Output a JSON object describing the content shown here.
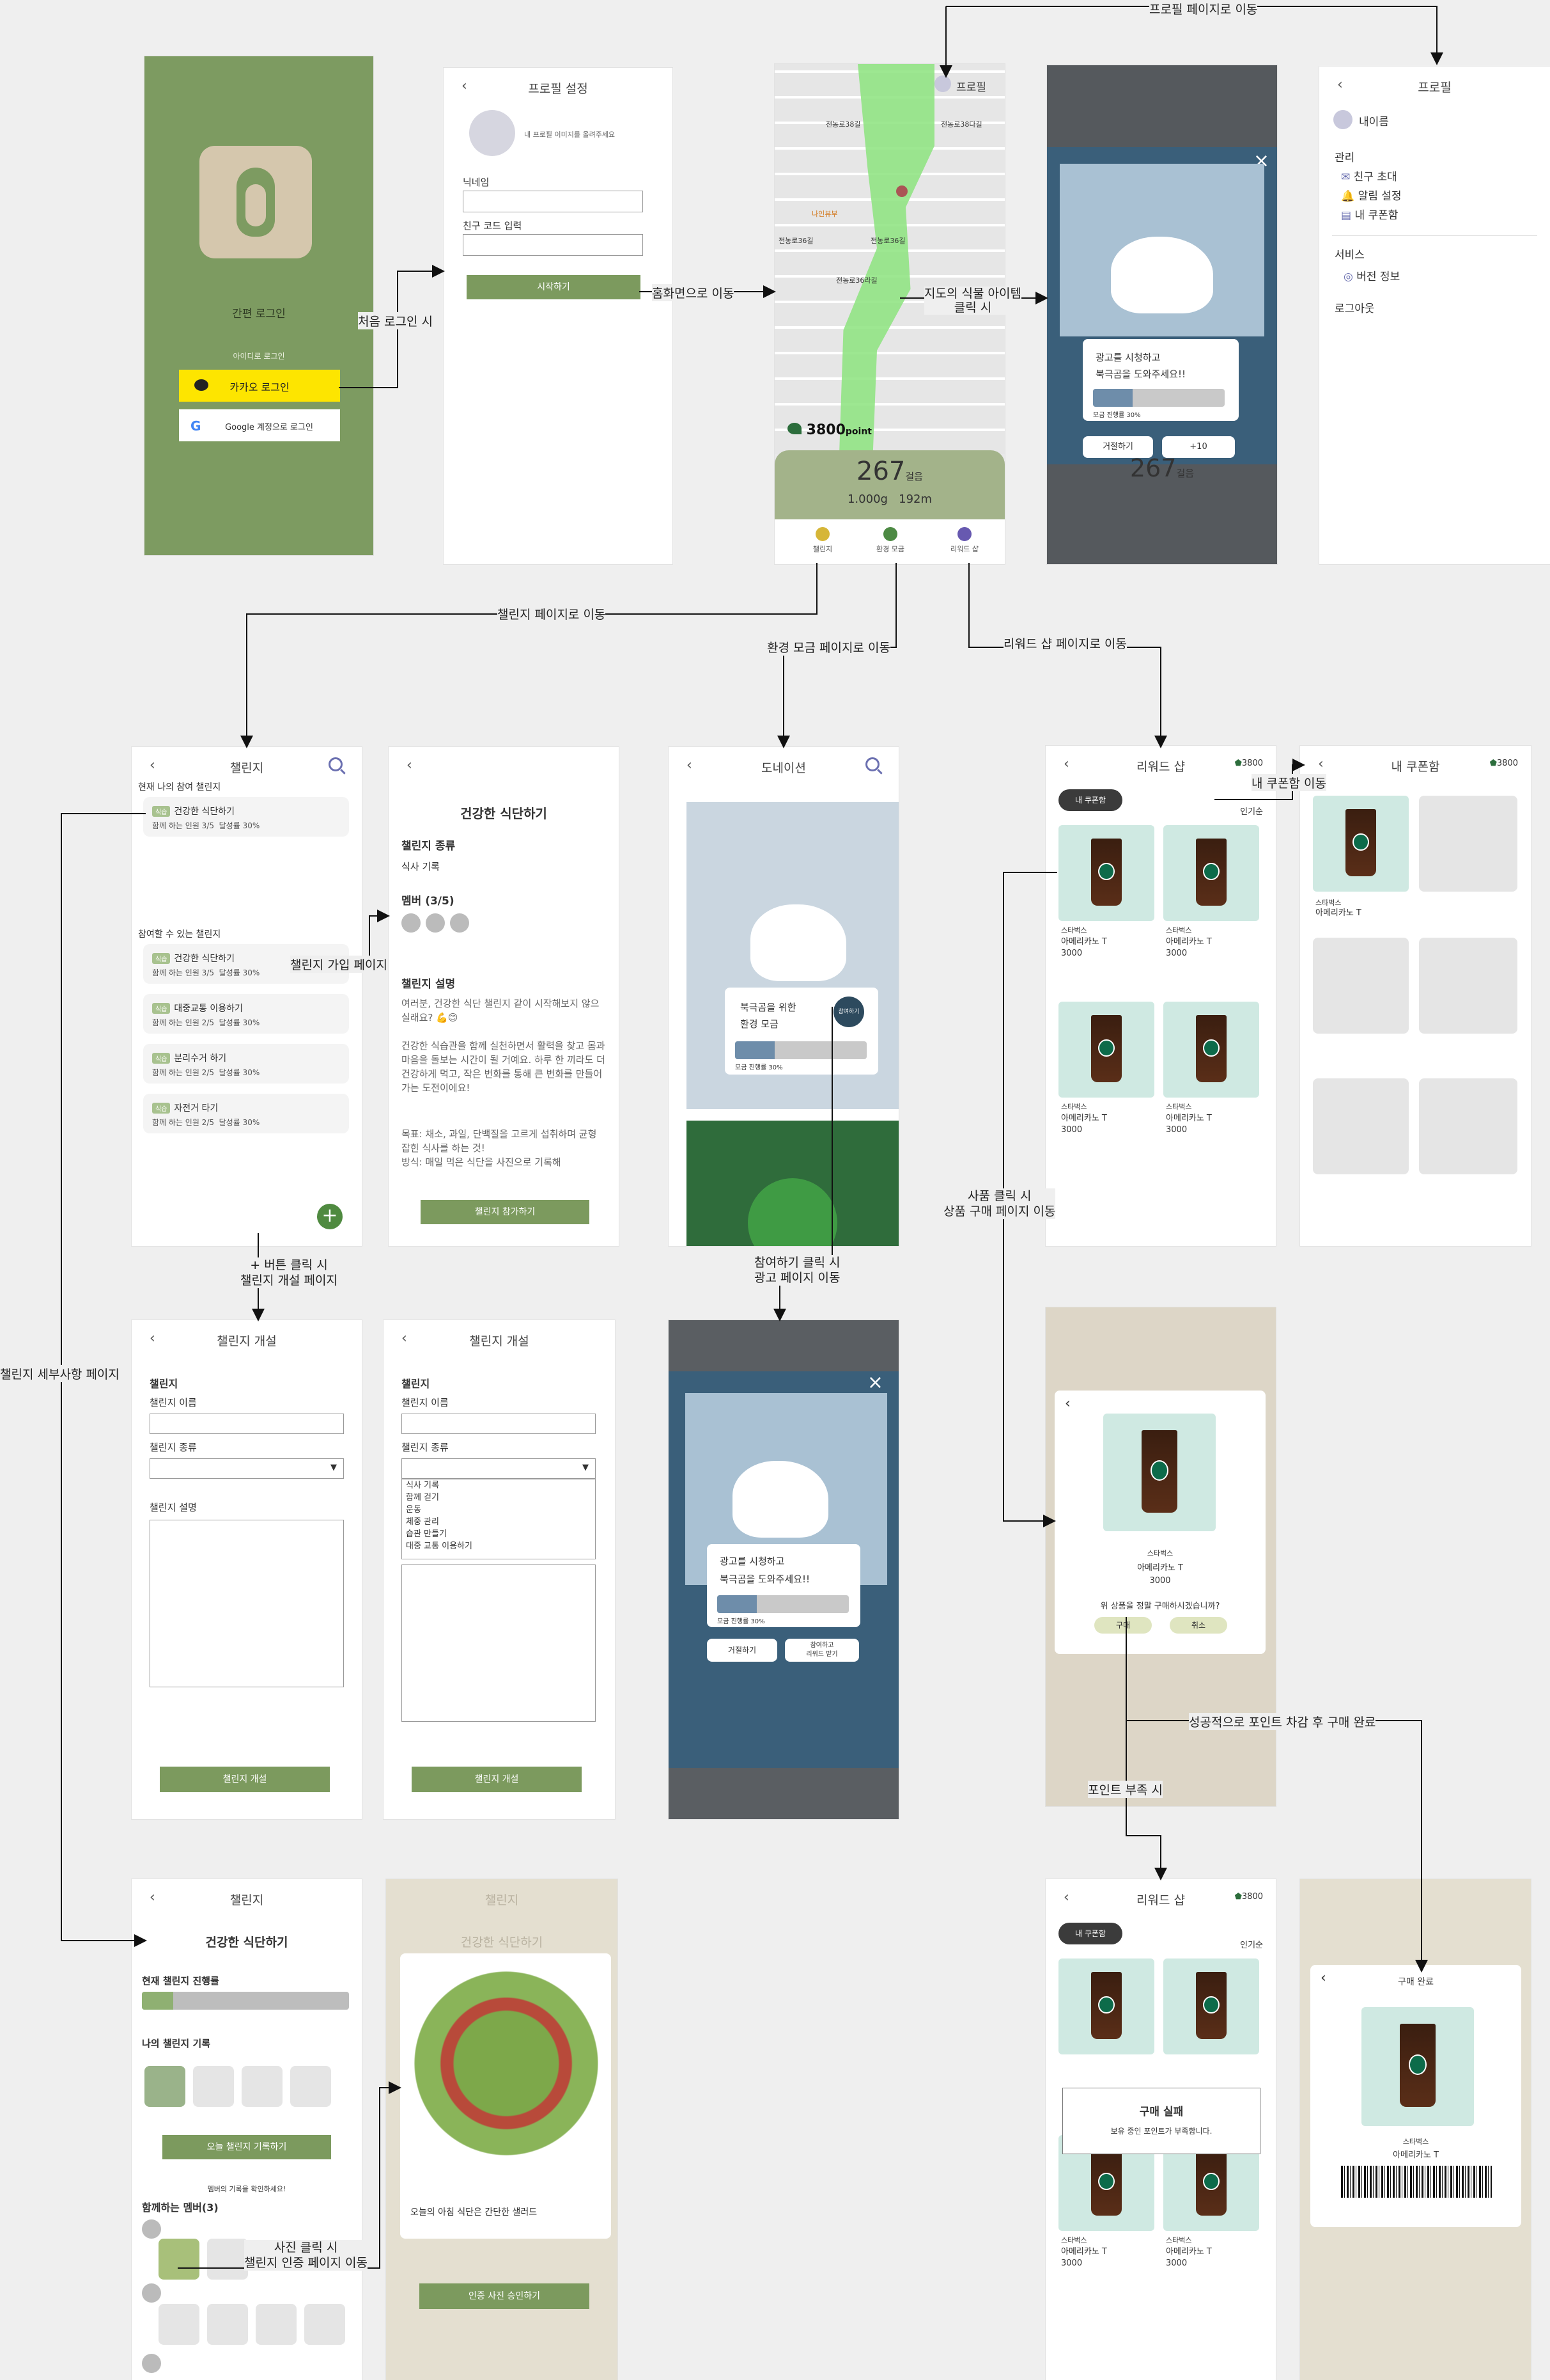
{
  "flow_labels": {
    "first_login": "처음 로그인 시",
    "to_home": "홈화면으로 이동",
    "plant_item_click": "지도의 식물 아이템\n클릭 시",
    "to_profile": "프로필 페이지로 이동",
    "to_challenge": "챌린지 페이지로 이동",
    "to_env": "환경 모금 페이지로 이동",
    "to_reward": "리워드 샵 페이지로 이동",
    "join_challenge": "챌린지 가입 페이지",
    "my_coupon_move": "내 쿠폰함 이동",
    "plus_click": "+ 버튼 클릭 시\n챌린지 개설 페이지",
    "participate_click": "참여하기 클릭 시\n광고 페이지 이동",
    "product_click": "사품 클릭 시\n상품 구매 페이지 이동",
    "challenge_detail": "챌린지 세부사항 페이지",
    "point_success": "성공적으로 포인트 차감 후 구매 완료",
    "point_short": "포인트 부족 시",
    "photo_click": "사진 클릭 시\n챌린지 인증 페이지 이동"
  },
  "login": {
    "simple_login": "간편 로그인",
    "id_login": "아이디로 로그인",
    "kakao": "카카오 로그인",
    "google": "Google 계정으로 로그인"
  },
  "profile_setup": {
    "title": "프로필 설정",
    "photo_hint": "내 프로필 이미지를 올려주세요",
    "nickname": "닉네임",
    "friend_code": "친구 코드 입력",
    "start": "시작하기"
  },
  "map": {
    "profile": "프로필",
    "points": "3800",
    "point_unit": "point",
    "steps": "267",
    "steps_unit": "걸음",
    "weight": "1.000g",
    "distance": "192m",
    "streets": [
      "전농로38길",
      "전농로38다길",
      "전농로36길",
      "전농로36길",
      "전농로36라길",
      "나인뷰부"
    ],
    "tabs": [
      "챌린지",
      "환경 모금",
      "리워드 샵"
    ]
  },
  "ad_popup": {
    "line1": "광고를 시청하고",
    "line2": "북극곰을 도와주세요!!",
    "progress_label": "모금 진행률 30%",
    "progress_percent": 30,
    "decline": "거절하기",
    "plus": "+10"
  },
  "profile_page": {
    "title": "프로필",
    "name": "내이름",
    "manage": "관리",
    "invite": "친구 초대",
    "alarm": "알림 설정",
    "coupons": "내 쿠폰함",
    "service": "서비스",
    "version": "버전 정보",
    "logout": "로그아웃"
  },
  "challenge_list": {
    "title": "챌린지",
    "current": "현재 나의 참여 챌린지",
    "available": "참여할 수 있는 챌린지",
    "tag": "식습",
    "items": [
      {
        "name": "건강한 식단하기",
        "members": "함께 하는 인원 3/5",
        "rate": "달성률 30%"
      },
      {
        "name": "건강한 식단하기",
        "members": "함께 하는 인원 3/5",
        "rate": "달성률 30%"
      },
      {
        "name": "대중교통 이용하기",
        "members": "함께 하는 인원 2/5",
        "rate": "달성률 30%"
      },
      {
        "name": "분리수거 하기",
        "members": "함께 하는 인원 2/5",
        "rate": "달성률 30%"
      },
      {
        "name": "자전거 타기",
        "members": "함께 하는 인원 2/5",
        "rate": "달성률 30%"
      }
    ]
  },
  "challenge_join": {
    "title": "건강한 식단하기",
    "kind_label": "챌린지 종류",
    "kind": "식사 기록",
    "members": "멤버 (3/5)",
    "desc_label": "챌린지 설명",
    "desc1": "여러분, 건강한 식단 챌린지 같이 시작해보지 않으실래요? 💪😊",
    "desc2": "건강한 식습관을 함께 실천하면서 활력을 찾고 몸과 마음을 돌보는 시간이 될 거예요. 하루 한 끼라도 더 건강하게 먹고, 작은 변화를 통해 큰 변화를 만들어가는 도전이에요!",
    "desc3": "목표: 채소, 과일, 단백질을 고르게 섭취하며 균형 잡힌 식사를 하는 것!\n방식: 매일 먹은 식단을 사진으로 기록해",
    "join": "챌린지 참가하기"
  },
  "donation": {
    "title": "도네이션",
    "line1": "북극곰을 위한",
    "line2": "환경 모금",
    "progress_label": "모금 진행률 30%",
    "participate": "참여하기",
    "decline": "거절하기",
    "get_reward": "참여하고\n리워드 받기"
  },
  "reward_shop": {
    "title": "리워드 샵",
    "points": "3800",
    "my_coupon": "내 쿠폰함",
    "popular": "인기순",
    "brand": "스타벅스",
    "product": "아메리카노 T",
    "price": "3000"
  },
  "my_coupon_page": {
    "title": "내 쿠폰함",
    "points": "3800",
    "brand": "스타벅스",
    "product": "아메리카노 T"
  },
  "challenge_create": {
    "title": "챌린지 개설",
    "section": "챌린지",
    "name_label": "챌린지 이름",
    "kind_label": "챌린지 종류",
    "desc_label": "챌린지 설명",
    "submit": "챌린지 개설",
    "options": [
      "식사 기록",
      "함께 걷기",
      "운동",
      "체중 관리",
      "습관 만들기",
      "대중 교통 이용하기"
    ]
  },
  "purchase": {
    "brand": "스타벅스",
    "product": "아메리카노 T",
    "price": "3000",
    "confirm": "위 상품을 정말 구매하시겠습니까?",
    "buy": "구매",
    "cancel": "취소"
  },
  "challenge_detail": {
    "title": "챌린지",
    "name": "건강한 식단하기",
    "progress_label": "현재 챌린지 진행률",
    "progress_percent": 15,
    "my_record": "나의 챌린지 기록",
    "record_button": "오늘 챌린지 기록하기",
    "member_hint": "멤버의 기록을 확인하세요!",
    "members": "함께하는 멤버(3)"
  },
  "verify": {
    "title": "챌린지",
    "name": "건강한 식단하기",
    "caption": "오늘의 아침 식단은 간단한 샐러드",
    "approve": "인증 사진 승인하기"
  },
  "fail": {
    "title": "구매 실패",
    "msg": "보유 중인 포인트가 부족합니다."
  },
  "complete": {
    "title": "구매 완료",
    "brand": "스타벅스",
    "product": "아메리카노 T"
  }
}
